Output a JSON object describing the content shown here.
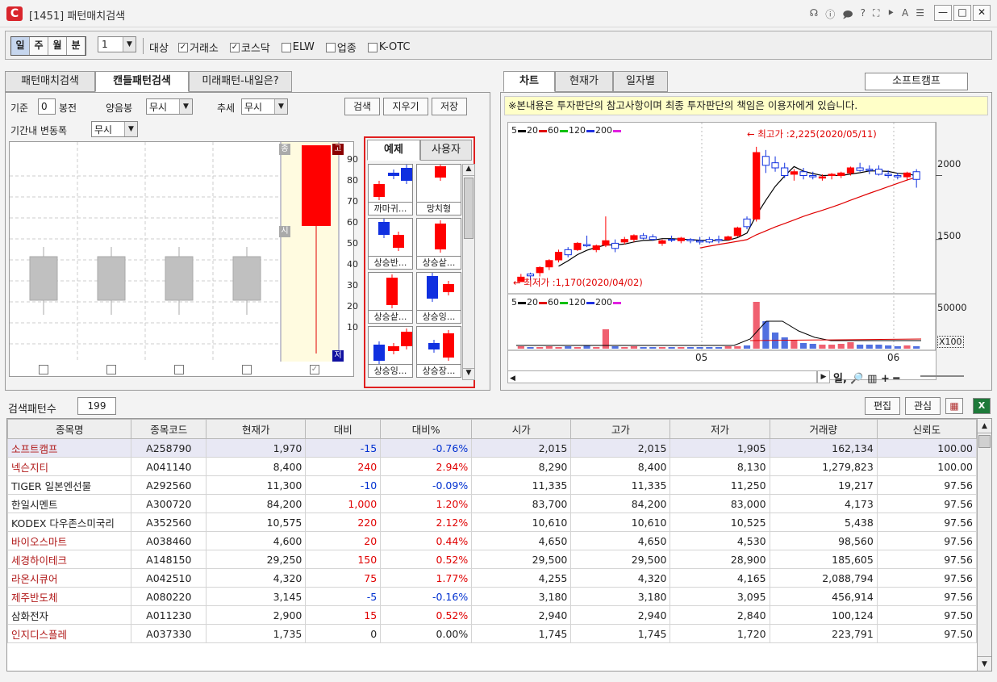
{
  "window": {
    "title": "[1451] 패턴매치검색",
    "min": "—",
    "max": "□",
    "close": "✕",
    "tools": [
      "☊",
      "ⓘ",
      "🗩",
      "?",
      "⛶",
      "⯈",
      "A",
      "☰"
    ]
  },
  "toolbar": {
    "periods": [
      "일",
      "주",
      "월",
      "분"
    ],
    "active_period": "일",
    "interval_value": "1",
    "target_label": "대상",
    "targets": [
      {
        "label": "거래소",
        "checked": true
      },
      {
        "label": "코스닥",
        "checked": true
      },
      {
        "label": "ELW",
        "checked": false
      },
      {
        "label": "업종",
        "checked": false
      },
      {
        "label": "K-OTC",
        "checked": false
      }
    ]
  },
  "left_tabs": [
    "패턴매치검색",
    "캔들패턴검색",
    "미래패턴-내일은?"
  ],
  "left_active_tab": "캔들패턴검색",
  "criteria": {
    "base_label": "기준",
    "base_value": "0",
    "bong_label": "봉전",
    "yang_label": "양음봉",
    "yang_value": "무시",
    "trend_label": "추세",
    "trend_value": "무시",
    "range_label": "기간내 변동폭",
    "range_value": "무시",
    "search_btn": "검색",
    "clear_btn": "지우기",
    "save_btn": "저장"
  },
  "candle_editor": {
    "labels": {
      "high": "고",
      "open": "시",
      "close": "저",
      "top": "종"
    },
    "scale": [
      "90",
      "80",
      "70",
      "60",
      "50",
      "40",
      "30",
      "20",
      "10"
    ],
    "checks": [
      false,
      false,
      false,
      false,
      true
    ]
  },
  "pattern_tabs": [
    "예제",
    "사용자"
  ],
  "patterns": [
    "까마귀...",
    "망치형",
    "상승반...",
    "상승샅...",
    "상승샅...",
    "상승잉...",
    "상승잉...",
    "상승장..."
  ],
  "right_tabs": [
    "차트",
    "현재가",
    "일자별"
  ],
  "right_active_tab": "차트",
  "stock_name": "소프트캠프",
  "notice": "※본내용은 투자판단의 참고사항이며 최종 투자판단의 책임은 이용자에게 있습니다.",
  "chart": {
    "ma_legend": "5━20━60━120━200━",
    "ma_items": [
      {
        "label": "5",
        "color": "#000000"
      },
      {
        "label": "20",
        "color": "#e00000"
      },
      {
        "label": "60",
        "color": "#10c010"
      },
      {
        "label": "120",
        "color": "#2030e0"
      },
      {
        "label": "200",
        "color": "#e020e0"
      }
    ],
    "high_label": "최고가 :2,225(2020/05/11)",
    "low_label": "최저가 :1,170(2020/04/02)",
    "price_ticks": [
      "2000",
      "1500"
    ],
    "volume_tick": "50000",
    "volume_unit": "X100",
    "x_labels": [
      "05",
      "06"
    ],
    "bottom_icons": "일, 🔎 ▥ + ━"
  },
  "chart_data": {
    "type": "candlestick",
    "ylim": [
      1100,
      2300
    ],
    "candles": [
      {
        "o": 1170,
        "h": 1230,
        "l": 1170,
        "c": 1205,
        "up": true
      },
      {
        "o": 1215,
        "h": 1240,
        "l": 1180,
        "c": 1230,
        "up": false
      },
      {
        "o": 1240,
        "h": 1290,
        "l": 1210,
        "c": 1280,
        "up": true
      },
      {
        "o": 1285,
        "h": 1345,
        "l": 1260,
        "c": 1335,
        "up": true
      },
      {
        "o": 1340,
        "h": 1420,
        "l": 1320,
        "c": 1400,
        "up": true
      },
      {
        "o": 1380,
        "h": 1440,
        "l": 1360,
        "c": 1420,
        "up": false
      },
      {
        "o": 1420,
        "h": 1480,
        "l": 1410,
        "c": 1470,
        "up": true
      },
      {
        "o": 1460,
        "h": 1530,
        "l": 1440,
        "c": 1450,
        "up": false
      },
      {
        "o": 1420,
        "h": 1460,
        "l": 1400,
        "c": 1450,
        "up": true
      },
      {
        "o": 1455,
        "h": 1680,
        "l": 1440,
        "c": 1490,
        "up": true
      },
      {
        "o": 1470,
        "h": 1500,
        "l": 1400,
        "c": 1430,
        "up": false
      },
      {
        "o": 1480,
        "h": 1520,
        "l": 1460,
        "c": 1500,
        "up": true
      },
      {
        "o": 1500,
        "h": 1540,
        "l": 1480,
        "c": 1530,
        "up": true
      },
      {
        "o": 1530,
        "h": 1550,
        "l": 1500,
        "c": 1510,
        "up": false
      },
      {
        "o": 1520,
        "h": 1540,
        "l": 1490,
        "c": 1500,
        "up": false
      },
      {
        "o": 1470,
        "h": 1500,
        "l": 1450,
        "c": 1490,
        "up": true
      },
      {
        "o": 1500,
        "h": 1530,
        "l": 1480,
        "c": 1500,
        "up": false
      },
      {
        "o": 1490,
        "h": 1520,
        "l": 1470,
        "c": 1510,
        "up": true
      },
      {
        "o": 1500,
        "h": 1510,
        "l": 1470,
        "c": 1490,
        "up": false
      },
      {
        "o": 1490,
        "h": 1520,
        "l": 1460,
        "c": 1480,
        "up": false
      },
      {
        "o": 1500,
        "h": 1520,
        "l": 1470,
        "c": 1480,
        "up": false
      },
      {
        "o": 1490,
        "h": 1530,
        "l": 1470,
        "c": 1500,
        "up": false
      },
      {
        "o": 1500,
        "h": 1530,
        "l": 1490,
        "c": 1520,
        "up": true
      },
      {
        "o": 1530,
        "h": 1600,
        "l": 1520,
        "c": 1590,
        "up": true
      },
      {
        "o": 1600,
        "h": 1680,
        "l": 1580,
        "c": 1660,
        "up": false
      },
      {
        "o": 1660,
        "h": 2225,
        "l": 1640,
        "c": 2180,
        "up": true
      },
      {
        "o": 2150,
        "h": 2200,
        "l": 2020,
        "c": 2080,
        "up": false
      },
      {
        "o": 2100,
        "h": 2150,
        "l": 2030,
        "c": 2060,
        "up": false
      },
      {
        "o": 2060,
        "h": 2100,
        "l": 1980,
        "c": 2000,
        "up": false
      },
      {
        "o": 2010,
        "h": 2050,
        "l": 1960,
        "c": 2030,
        "up": true
      },
      {
        "o": 2030,
        "h": 2060,
        "l": 1970,
        "c": 2000,
        "up": false
      },
      {
        "o": 2000,
        "h": 2030,
        "l": 1970,
        "c": 1990,
        "up": false
      },
      {
        "o": 1990,
        "h": 2010,
        "l": 1960,
        "c": 1980,
        "up": true
      },
      {
        "o": 2000,
        "h": 2020,
        "l": 1970,
        "c": 2010,
        "up": true
      },
      {
        "o": 2000,
        "h": 2030,
        "l": 1980,
        "c": 2020,
        "up": true
      },
      {
        "o": 2020,
        "h": 2070,
        "l": 2000,
        "c": 2060,
        "up": true
      },
      {
        "o": 2060,
        "h": 2100,
        "l": 2030,
        "c": 2040,
        "up": false
      },
      {
        "o": 2040,
        "h": 2080,
        "l": 2010,
        "c": 2050,
        "up": false
      },
      {
        "o": 2050,
        "h": 2080,
        "l": 2000,
        "c": 2010,
        "up": false
      },
      {
        "o": 2010,
        "h": 2040,
        "l": 1980,
        "c": 2000,
        "up": false
      },
      {
        "o": 2000,
        "h": 2020,
        "l": 1970,
        "c": 1990,
        "up": false
      },
      {
        "o": 1990,
        "h": 2030,
        "l": 1960,
        "c": 2020,
        "up": true
      },
      {
        "o": 2030,
        "h": 2050,
        "l": 1905,
        "c": 1970,
        "up": false
      }
    ],
    "volume": [
      3,
      2,
      2,
      3,
      2,
      3,
      2,
      4,
      2,
      24,
      3,
      2,
      3,
      2,
      2,
      2,
      2,
      2,
      2,
      2,
      2,
      2,
      3,
      3,
      4,
      58,
      34,
      20,
      14,
      10,
      7,
      6,
      5,
      5,
      6,
      8,
      5,
      5,
      5,
      4,
      3,
      4,
      3
    ]
  },
  "results": {
    "count_label": "검색패턴수",
    "count": "199",
    "edit_btn": "편집",
    "watch_btn": "관심",
    "columns": [
      "종목명",
      "종목코드",
      "현재가",
      "대비",
      "대비%",
      "시가",
      "고가",
      "저가",
      "거래량",
      "신뢰도"
    ],
    "rows": [
      {
        "name": "소프트캠프",
        "code": "A258790",
        "price": "1,970",
        "diff": "-15",
        "pct": "-0.76%",
        "open": "2,015",
        "high": "2,015",
        "low": "1,905",
        "vol": "162,134",
        "conf": "100.00",
        "dir": "dn",
        "kosdaq": true
      },
      {
        "name": "넥슨지티",
        "code": "A041140",
        "price": "8,400",
        "diff": "240",
        "pct": "2.94%",
        "open": "8,290",
        "high": "8,400",
        "low": "8,130",
        "vol": "1,279,823",
        "conf": "100.00",
        "dir": "up",
        "kosdaq": true
      },
      {
        "name": "TIGER 일본엔선물",
        "code": "A292560",
        "price": "11,300",
        "diff": "-10",
        "pct": "-0.09%",
        "open": "11,335",
        "high": "11,335",
        "low": "11,250",
        "vol": "19,217",
        "conf": "97.56",
        "dir": "dn",
        "kosdaq": false
      },
      {
        "name": "한일시멘트",
        "code": "A300720",
        "price": "84,200",
        "diff": "1,000",
        "pct": "1.20%",
        "open": "83,700",
        "high": "84,200",
        "low": "83,000",
        "vol": "4,173",
        "conf": "97.56",
        "dir": "up",
        "kosdaq": false
      },
      {
        "name": "KODEX 다우존스미국리",
        "code": "A352560",
        "price": "10,575",
        "diff": "220",
        "pct": "2.12%",
        "open": "10,610",
        "high": "10,610",
        "low": "10,525",
        "vol": "5,438",
        "conf": "97.56",
        "dir": "up",
        "kosdaq": false
      },
      {
        "name": "바이오스마트",
        "code": "A038460",
        "price": "4,600",
        "diff": "20",
        "pct": "0.44%",
        "open": "4,650",
        "high": "4,650",
        "low": "4,530",
        "vol": "98,560",
        "conf": "97.56",
        "dir": "up",
        "kosdaq": true
      },
      {
        "name": "세경하이테크",
        "code": "A148150",
        "price": "29,250",
        "diff": "150",
        "pct": "0.52%",
        "open": "29,500",
        "high": "29,500",
        "low": "28,900",
        "vol": "185,605",
        "conf": "97.56",
        "dir": "up",
        "kosdaq": true
      },
      {
        "name": "라온시큐어",
        "code": "A042510",
        "price": "4,320",
        "diff": "75",
        "pct": "1.77%",
        "open": "4,255",
        "high": "4,320",
        "low": "4,165",
        "vol": "2,088,794",
        "conf": "97.56",
        "dir": "up",
        "kosdaq": true
      },
      {
        "name": "제주반도체",
        "code": "A080220",
        "price": "3,145",
        "diff": "-5",
        "pct": "-0.16%",
        "open": "3,180",
        "high": "3,180",
        "low": "3,095",
        "vol": "456,914",
        "conf": "97.56",
        "dir": "dn",
        "kosdaq": true
      },
      {
        "name": "삼화전자",
        "code": "A011230",
        "price": "2,900",
        "diff": "15",
        "pct": "0.52%",
        "open": "2,940",
        "high": "2,940",
        "low": "2,840",
        "vol": "100,124",
        "conf": "97.50",
        "dir": "up",
        "kosdaq": false
      },
      {
        "name": "인지디스플레",
        "code": "A037330",
        "price": "1,735",
        "diff": "0",
        "pct": "0.00%",
        "open": "1,745",
        "high": "1,745",
        "low": "1,720",
        "vol": "223,791",
        "conf": "97.50",
        "dir": "flat",
        "kosdaq": true
      }
    ]
  }
}
